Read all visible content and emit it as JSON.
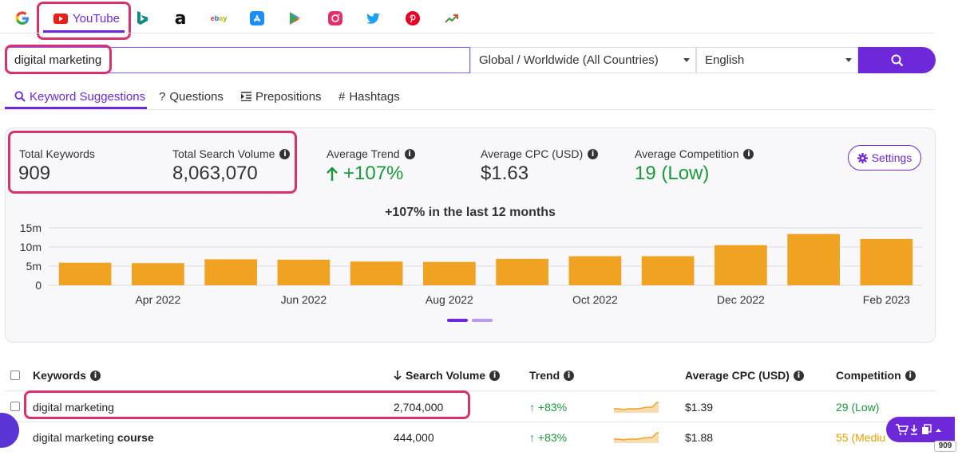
{
  "sources": [
    {
      "name": "google",
      "icon": "google-icon"
    },
    {
      "name": "youtube",
      "label": "YouTube",
      "icon": "youtube-icon",
      "active": true
    },
    {
      "name": "bing",
      "icon": "bing-icon"
    },
    {
      "name": "amazon",
      "icon": "amazon-icon"
    },
    {
      "name": "ebay",
      "label": "ebay",
      "icon": "ebay-icon"
    },
    {
      "name": "app-store",
      "icon": "app-store-icon"
    },
    {
      "name": "play-store",
      "icon": "play-store-icon"
    },
    {
      "name": "instagram",
      "icon": "instagram-icon"
    },
    {
      "name": "twitter",
      "icon": "twitter-icon"
    },
    {
      "name": "pinterest",
      "icon": "pinterest-icon"
    },
    {
      "name": "trends",
      "icon": "trend-chart-icon"
    }
  ],
  "search": {
    "value": "digital marketing",
    "location": "Global / Worldwide (All Countries)",
    "language": "English",
    "button_icon": "search-icon"
  },
  "tabs": [
    {
      "label": "Keyword Suggestions",
      "icon": "search-icon",
      "active": true
    },
    {
      "label": "Questions",
      "icon": "question-icon"
    },
    {
      "label": "Prepositions",
      "icon": "indent-icon"
    },
    {
      "label": "Hashtags",
      "icon": "hash-icon"
    }
  ],
  "stats": {
    "total_keywords_label": "Total Keywords",
    "total_keywords": "909",
    "total_volume_label": "Total Search Volume",
    "total_volume": "8,063,070",
    "avg_trend_label": "Average Trend",
    "avg_trend": "+107%",
    "avg_cpc_label": "Average CPC (USD)",
    "avg_cpc": "$1.63",
    "avg_competition_label": "Average Competition",
    "avg_competition": "19 (Low)",
    "settings_label": "Settings"
  },
  "colors": {
    "accent": "#6d28d9",
    "bar": "#f0a323",
    "green": "#1a9a3a",
    "highlight": "#d6336c",
    "medium": "#e6a100"
  },
  "chart_data": {
    "type": "bar",
    "title": "+107% in the last 12 months",
    "categories": [
      "Mar 2022",
      "Apr 2022",
      "May 2022",
      "Jun 2022",
      "Jul 2022",
      "Aug 2022",
      "Sep 2022",
      "Oct 2022",
      "Nov 2022",
      "Dec 2022",
      "Jan 2023",
      "Feb 2023"
    ],
    "values": [
      5.9,
      5.8,
      6.8,
      6.7,
      6.2,
      6.1,
      6.9,
      7.6,
      7.6,
      10.5,
      13.4,
      12.1
    ],
    "unit": "m",
    "x_tick_labels": [
      "Apr 2022",
      "Jun 2022",
      "Aug 2022",
      "Oct 2022",
      "Dec 2022",
      "Feb 2023"
    ],
    "y_ticks": [
      "0",
      "5m",
      "10m",
      "15m"
    ],
    "ylim": [
      0,
      15
    ],
    "grid": true,
    "legend": "none"
  },
  "table": {
    "headers": {
      "keywords": "Keywords",
      "volume": "Search Volume",
      "trend": "Trend",
      "cpc": "Average CPC (USD)",
      "competition": "Competition"
    },
    "rows": [
      {
        "keyword": "digital marketing",
        "keyword_bold": "",
        "volume": "2,704,000",
        "trend": "+83%",
        "cpc": "$1.39",
        "competition": "29 (Low)",
        "level": "low"
      },
      {
        "keyword": "digital marketing",
        "keyword_bold": "course",
        "volume": "444,000",
        "trend": "+83%",
        "cpc": "$1.88",
        "competition": "55 (Mediu",
        "level": "medium"
      }
    ]
  },
  "export_badge": "909"
}
